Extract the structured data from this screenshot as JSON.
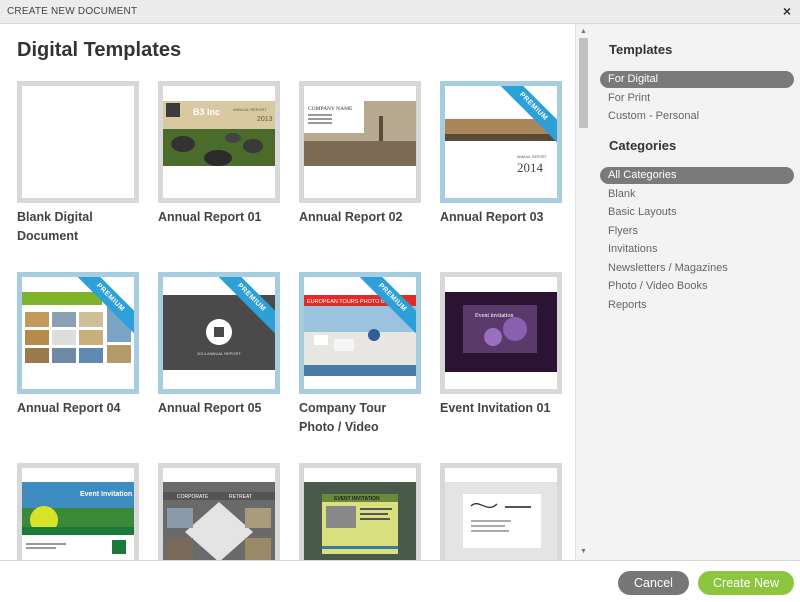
{
  "window": {
    "title": "CREATE NEW DOCUMENT",
    "close_glyph": "×"
  },
  "main": {
    "heading": "Digital Templates"
  },
  "templates": [
    {
      "label": "Blank Digital Document",
      "premium": false
    },
    {
      "label": "Annual Report 01",
      "premium": false,
      "thumb_text": "B3 Inc",
      "thumb_sub": "ANNUAL REPORT",
      "thumb_year": "2013"
    },
    {
      "label": "Annual Report 02",
      "premium": false,
      "thumb_text": "COMPANY NAME"
    },
    {
      "label": "Annual Report 03",
      "premium": true,
      "thumb_text": "ANNUAL REPORT",
      "thumb_year": "2014"
    },
    {
      "label": "Annual Report 04",
      "premium": true
    },
    {
      "label": "Annual Report 05",
      "premium": true,
      "thumb_text": "2014 ANNUAL REPORT"
    },
    {
      "label": "Company Tour Photo / Video",
      "premium": true,
      "thumb_text": "EUROPEAN TOURS PHOTO BOOK"
    },
    {
      "label": "Event Invitation 01",
      "premium": false,
      "thumb_text": "Event invitation"
    },
    {
      "label": "",
      "premium": false,
      "thumb_text": "Event Invitation"
    },
    {
      "label": "",
      "premium": false,
      "thumb_text": "CORPORATE",
      "thumb_sub": "RETREAT"
    },
    {
      "label": "",
      "premium": false,
      "thumb_text": "EVENT INVITATION"
    },
    {
      "label": "",
      "premium": false
    }
  ],
  "premium_label": "PREMIUM",
  "sidebar": {
    "templates_heading": "Templates",
    "templates_items": [
      "For Digital",
      "For Print",
      "Custom - Personal"
    ],
    "categories_heading": "Categories",
    "categories_items": [
      "All Categories",
      "Blank",
      "Basic Layouts",
      "Flyers",
      "Invitations",
      "Newsletters / Magazines",
      "Photo / Video Books",
      "Reports"
    ]
  },
  "footer": {
    "cancel_label": "Cancel",
    "create_label": "Create New"
  },
  "colors": {
    "premium_ribbon": "#2ea0d8",
    "create_button": "#8cc63f",
    "cancel_button": "#777777",
    "active_item": "#7a7a7a"
  }
}
